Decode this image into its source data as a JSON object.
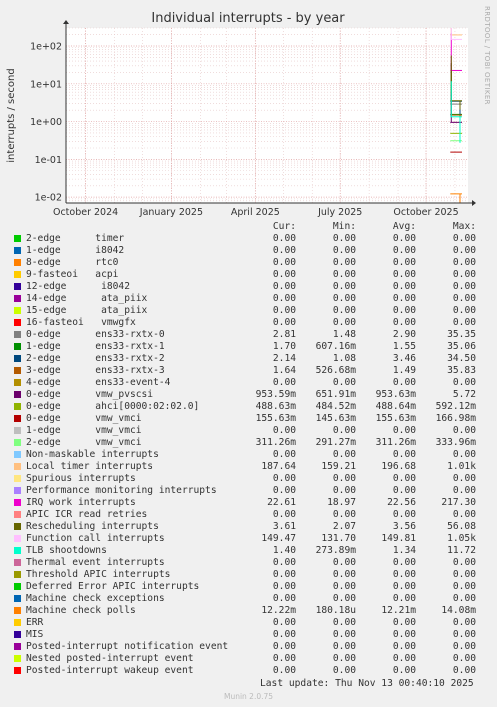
{
  "chart_data": {
    "type": "line",
    "title": "Individual interrupts - by year",
    "ylabel": "interrupts / second",
    "side_label": "RRDTOOL / TOBI OETIKER",
    "yscale": "log",
    "ylim": [
      0.007,
      300
    ],
    "y_ticks": [
      {
        "v": 0.01,
        "label": "1e-02"
      },
      {
        "v": 0.1,
        "label": "1e-01"
      },
      {
        "v": 1,
        "label": "1e+00"
      },
      {
        "v": 10,
        "label": "1e+01"
      },
      {
        "v": 100,
        "label": "1e+02"
      }
    ],
    "x_range": [
      "2024-09-10",
      "2025-11-15"
    ],
    "x_ticks": [
      {
        "date": "2024-10-01",
        "label": "October 2024"
      },
      {
        "date": "2025-01-01",
        "label": "January 2025"
      },
      {
        "date": "2025-04-01",
        "label": "April 2025"
      },
      {
        "date": "2025-07-01",
        "label": "July 2025"
      },
      {
        "date": "2025-10-01",
        "label": "October 2025"
      }
    ],
    "grid": true,
    "data_start": "2025-10-27",
    "columns": [
      "Cur:",
      "Min:",
      "Avg:",
      "Max:"
    ],
    "series": [
      {
        "name": "2-edge      timer",
        "color": "#00cc00",
        "cur": "0.00",
        "min": "0.00",
        "avg": "0.00",
        "max": "0.00"
      },
      {
        "name": "1-edge      i8042",
        "color": "#0066b3",
        "cur": "0.00",
        "min": "0.00",
        "avg": "0.00",
        "max": "0.00"
      },
      {
        "name": "8-edge      rtc0",
        "color": "#ff8000",
        "cur": "0.00",
        "min": "0.00",
        "avg": "0.00",
        "max": "0.00"
      },
      {
        "name": "9-fasteoi   acpi",
        "color": "#ffcc00",
        "cur": "0.00",
        "min": "0.00",
        "avg": "0.00",
        "max": "0.00"
      },
      {
        "name": "12-edge      i8042",
        "color": "#330099",
        "cur": "0.00",
        "min": "0.00",
        "avg": "0.00",
        "max": "0.00"
      },
      {
        "name": "14-edge      ata_piix",
        "color": "#990099",
        "cur": "0.00",
        "min": "0.00",
        "avg": "0.00",
        "max": "0.00"
      },
      {
        "name": "15-edge      ata_piix",
        "color": "#ccff00",
        "cur": "0.00",
        "min": "0.00",
        "avg": "0.00",
        "max": "0.00"
      },
      {
        "name": "16-fasteoi   vmwgfx",
        "color": "#ff0000",
        "cur": "0.00",
        "min": "0.00",
        "avg": "0.00",
        "max": "0.00"
      },
      {
        "name": "0-edge      ens33-rxtx-0",
        "color": "#808080",
        "cur": "2.81",
        "min": "1.48",
        "avg": "2.90",
        "max": "35.35"
      },
      {
        "name": "1-edge      ens33-rxtx-1",
        "color": "#008f00",
        "cur": "1.70",
        "min": "607.16m",
        "avg": "1.55",
        "max": "35.06"
      },
      {
        "name": "2-edge      ens33-rxtx-2",
        "color": "#00487d",
        "cur": "2.14",
        "min": "1.08",
        "avg": "3.46",
        "max": "34.50"
      },
      {
        "name": "3-edge      ens33-rxtx-3",
        "color": "#b35a00",
        "cur": "1.64",
        "min": "526.68m",
        "avg": "1.49",
        "max": "35.83"
      },
      {
        "name": "4-edge      ens33-event-4",
        "color": "#b38f00",
        "cur": "0.00",
        "min": "0.00",
        "avg": "0.00",
        "max": "0.00"
      },
      {
        "name": "0-edge      vmw_pvscsi",
        "color": "#6b006b",
        "cur": "953.59m",
        "min": "651.91m",
        "avg": "953.63m",
        "max": "5.72"
      },
      {
        "name": "0-edge      ahci[0000:02:02.0]",
        "color": "#8fb300",
        "cur": "488.63m",
        "min": "484.52m",
        "avg": "488.64m",
        "max": "592.12m"
      },
      {
        "name": "0-edge      vmw_vmci",
        "color": "#b30000",
        "cur": "155.63m",
        "min": "145.63m",
        "avg": "155.63m",
        "max": "166.98m"
      },
      {
        "name": "1-edge      vmw_vmci",
        "color": "#bebebe",
        "cur": "0.00",
        "min": "0.00",
        "avg": "0.00",
        "max": "0.00"
      },
      {
        "name": "2-edge      vmw_vmci",
        "color": "#80ff80",
        "cur": "311.26m",
        "min": "291.27m",
        "avg": "311.26m",
        "max": "333.96m"
      },
      {
        "name": "Non-maskable interrupts",
        "color": "#80c9ff",
        "cur": "0.00",
        "min": "0.00",
        "avg": "0.00",
        "max": "0.00"
      },
      {
        "name": "Local timer interrupts",
        "color": "#ffc080",
        "cur": "187.64",
        "min": "159.21",
        "avg": "196.68",
        "max": "1.01k"
      },
      {
        "name": "Spurious interrupts",
        "color": "#ffe680",
        "cur": "0.00",
        "min": "0.00",
        "avg": "0.00",
        "max": "0.00"
      },
      {
        "name": "Performance monitoring interrupts",
        "color": "#aa80ff",
        "cur": "0.00",
        "min": "0.00",
        "avg": "0.00",
        "max": "0.00"
      },
      {
        "name": "IRQ work interrupts",
        "color": "#ee00cc",
        "cur": "22.61",
        "min": "18.97",
        "avg": "22.56",
        "max": "217.30"
      },
      {
        "name": "APIC ICR read retries",
        "color": "#ff8080",
        "cur": "0.00",
        "min": "0.00",
        "avg": "0.00",
        "max": "0.00"
      },
      {
        "name": "Rescheduling interrupts",
        "color": "#666600",
        "cur": "3.61",
        "min": "2.07",
        "avg": "3.56",
        "max": "56.08"
      },
      {
        "name": "Function call interrupts",
        "color": "#ffbfff",
        "cur": "149.47",
        "min": "131.70",
        "avg": "149.81",
        "max": "1.05k"
      },
      {
        "name": "TLB shootdowns",
        "color": "#00ffcc",
        "cur": "1.40",
        "min": "273.89m",
        "avg": "1.34",
        "max": "11.72"
      },
      {
        "name": "Thermal event interrupts",
        "color": "#cc6699",
        "cur": "0.00",
        "min": "0.00",
        "avg": "0.00",
        "max": "0.00"
      },
      {
        "name": "Threshold APIC interrupts",
        "color": "#999900",
        "cur": "0.00",
        "min": "0.00",
        "avg": "0.00",
        "max": "0.00"
      },
      {
        "name": "Deferred Error APIC interrupts",
        "color": "#00cc00",
        "cur": "0.00",
        "min": "0.00",
        "avg": "0.00",
        "max": "0.00"
      },
      {
        "name": "Machine check exceptions",
        "color": "#0066b3",
        "cur": "0.00",
        "min": "0.00",
        "avg": "0.00",
        "max": "0.00"
      },
      {
        "name": "Machine check polls",
        "color": "#ff8000",
        "cur": "12.22m",
        "min": "180.18u",
        "avg": "12.21m",
        "max": "14.08m"
      },
      {
        "name": "ERR",
        "color": "#ffcc00",
        "cur": "0.00",
        "min": "0.00",
        "avg": "0.00",
        "max": "0.00"
      },
      {
        "name": "MIS",
        "color": "#330099",
        "cur": "0.00",
        "min": "0.00",
        "avg": "0.00",
        "max": "0.00"
      },
      {
        "name": "Posted-interrupt notification event",
        "color": "#990099",
        "cur": "0.00",
        "min": "0.00",
        "avg": "0.00",
        "max": "0.00"
      },
      {
        "name": "Nested posted-interrupt event",
        "color": "#ccff00",
        "cur": "0.00",
        "min": "0.00",
        "avg": "0.00",
        "max": "0.00"
      },
      {
        "name": "Posted-interrupt wakeup event",
        "color": "#ff0000",
        "cur": "0.00",
        "min": "0.00",
        "avg": "0.00",
        "max": "0.00"
      }
    ]
  },
  "last_update": "Last update: Thu Nov 13 00:40:10 2025",
  "footer": "Munin 2.0.75"
}
